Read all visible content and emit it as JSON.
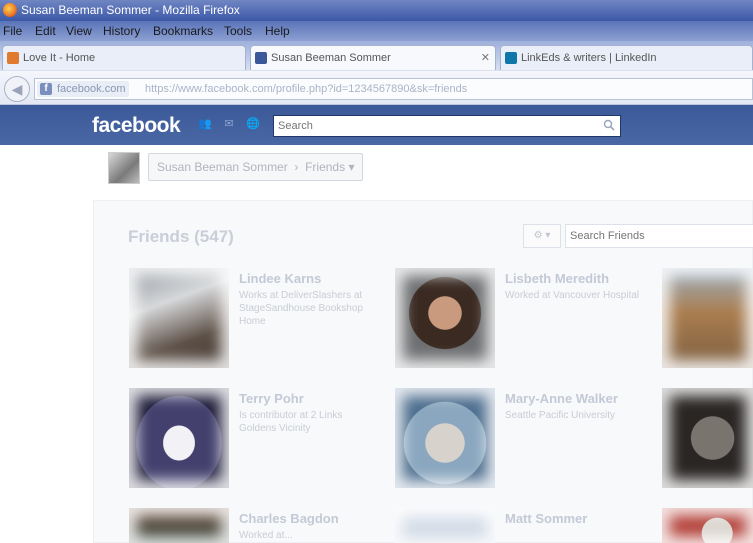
{
  "window": {
    "title": "Susan Beeman Sommer - Mozilla Firefox"
  },
  "menu": [
    "File",
    "Edit",
    "View",
    "History",
    "Bookmarks",
    "Tools",
    "Help"
  ],
  "tabs": [
    {
      "label": "Love It - Home",
      "icon": "rss-icon"
    },
    {
      "label": "Susan Beeman Sommer",
      "icon": "facebook-icon",
      "active": true
    },
    {
      "label": "LinkEds & writers | LinkedIn",
      "icon": "linkedin-icon"
    }
  ],
  "navbar": {
    "site_identity": "facebook.com",
    "url": "https://www.facebook.com/profile.php?id=1234567890&sk=friends"
  },
  "facebook": {
    "logo": "facebook",
    "search_placeholder": "Search"
  },
  "profile": {
    "name": "Susan Beeman Sommer",
    "friends_button": "Friends"
  },
  "friends": {
    "heading": "Friends (547)",
    "search_placeholder": "Search Friends",
    "cards": [
      {
        "name": "Lindee Karns",
        "detail": "Works at DeliverSlashers at StageSandhouse Bookshop Home"
      },
      {
        "name": "Lisbeth Meredith",
        "detail": "Worked at Vancouver Hospital"
      },
      {
        "name": "",
        "detail": ""
      },
      {
        "name": "Terry Pohr",
        "detail": "Is contributor at 2 Links Goldens Vicinity"
      },
      {
        "name": "Mary-Anne Walker",
        "detail": "Seattle Pacific University"
      },
      {
        "name": "",
        "detail": ""
      },
      {
        "name": "Charles Bagdon",
        "detail": "Worked at..."
      },
      {
        "name": "Matt Sommer",
        "detail": ""
      },
      {
        "name": "",
        "detail": ""
      }
    ]
  }
}
